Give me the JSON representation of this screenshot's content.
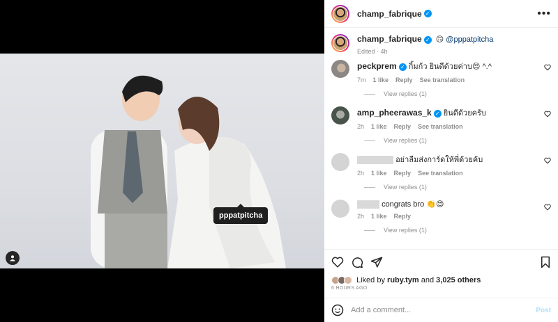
{
  "post": {
    "author": "champ_fabrique",
    "tag_label": "pppatpitcha"
  },
  "caption": {
    "author": "champ_fabrique",
    "emoji": "🙃",
    "mention": "@pppatpitcha",
    "edited": "Edited · 4h"
  },
  "comments": [
    {
      "user": "peckprem",
      "text": "กิ้มก้ว ยินดีด้วยค่าบ😍 ^.^",
      "time": "7m",
      "likes": "1 like",
      "reply": "Reply",
      "translate": "See translation",
      "view_replies": "View replies (1)"
    },
    {
      "user": "amp_pheerawas_k",
      "text": "ยินดีด้วยครับ",
      "time": "2h",
      "likes": "1 like",
      "reply": "Reply",
      "translate": "See translation",
      "view_replies": "View replies (1)"
    },
    {
      "user": "",
      "text": "อย่าลืมส่งการ์ดให้พี่ด้วยค้บ",
      "time": "2h",
      "likes": "1 like",
      "reply": "Reply",
      "translate": "See translation",
      "view_replies": "View replies (1)"
    },
    {
      "user": "",
      "text": "congrats bro 👏😍",
      "time": "2h",
      "likes": "1 like",
      "reply": "Reply",
      "view_replies": "View replies (1)"
    }
  ],
  "likes": {
    "prefix": "Liked by",
    "user": "ruby.tym",
    "and": "and",
    "others": "3,025 others",
    "ago": "6 HOURS AGO"
  },
  "composer": {
    "placeholder": "Add a comment...",
    "post_label": "Post"
  },
  "icons": {
    "verified": "✓",
    "more": "more-dots-icon",
    "heart": "heart-icon",
    "comment": "comment-icon",
    "share": "share-icon",
    "save": "save-icon",
    "emoji": "emoji-icon",
    "tag": "user-tag-icon"
  }
}
